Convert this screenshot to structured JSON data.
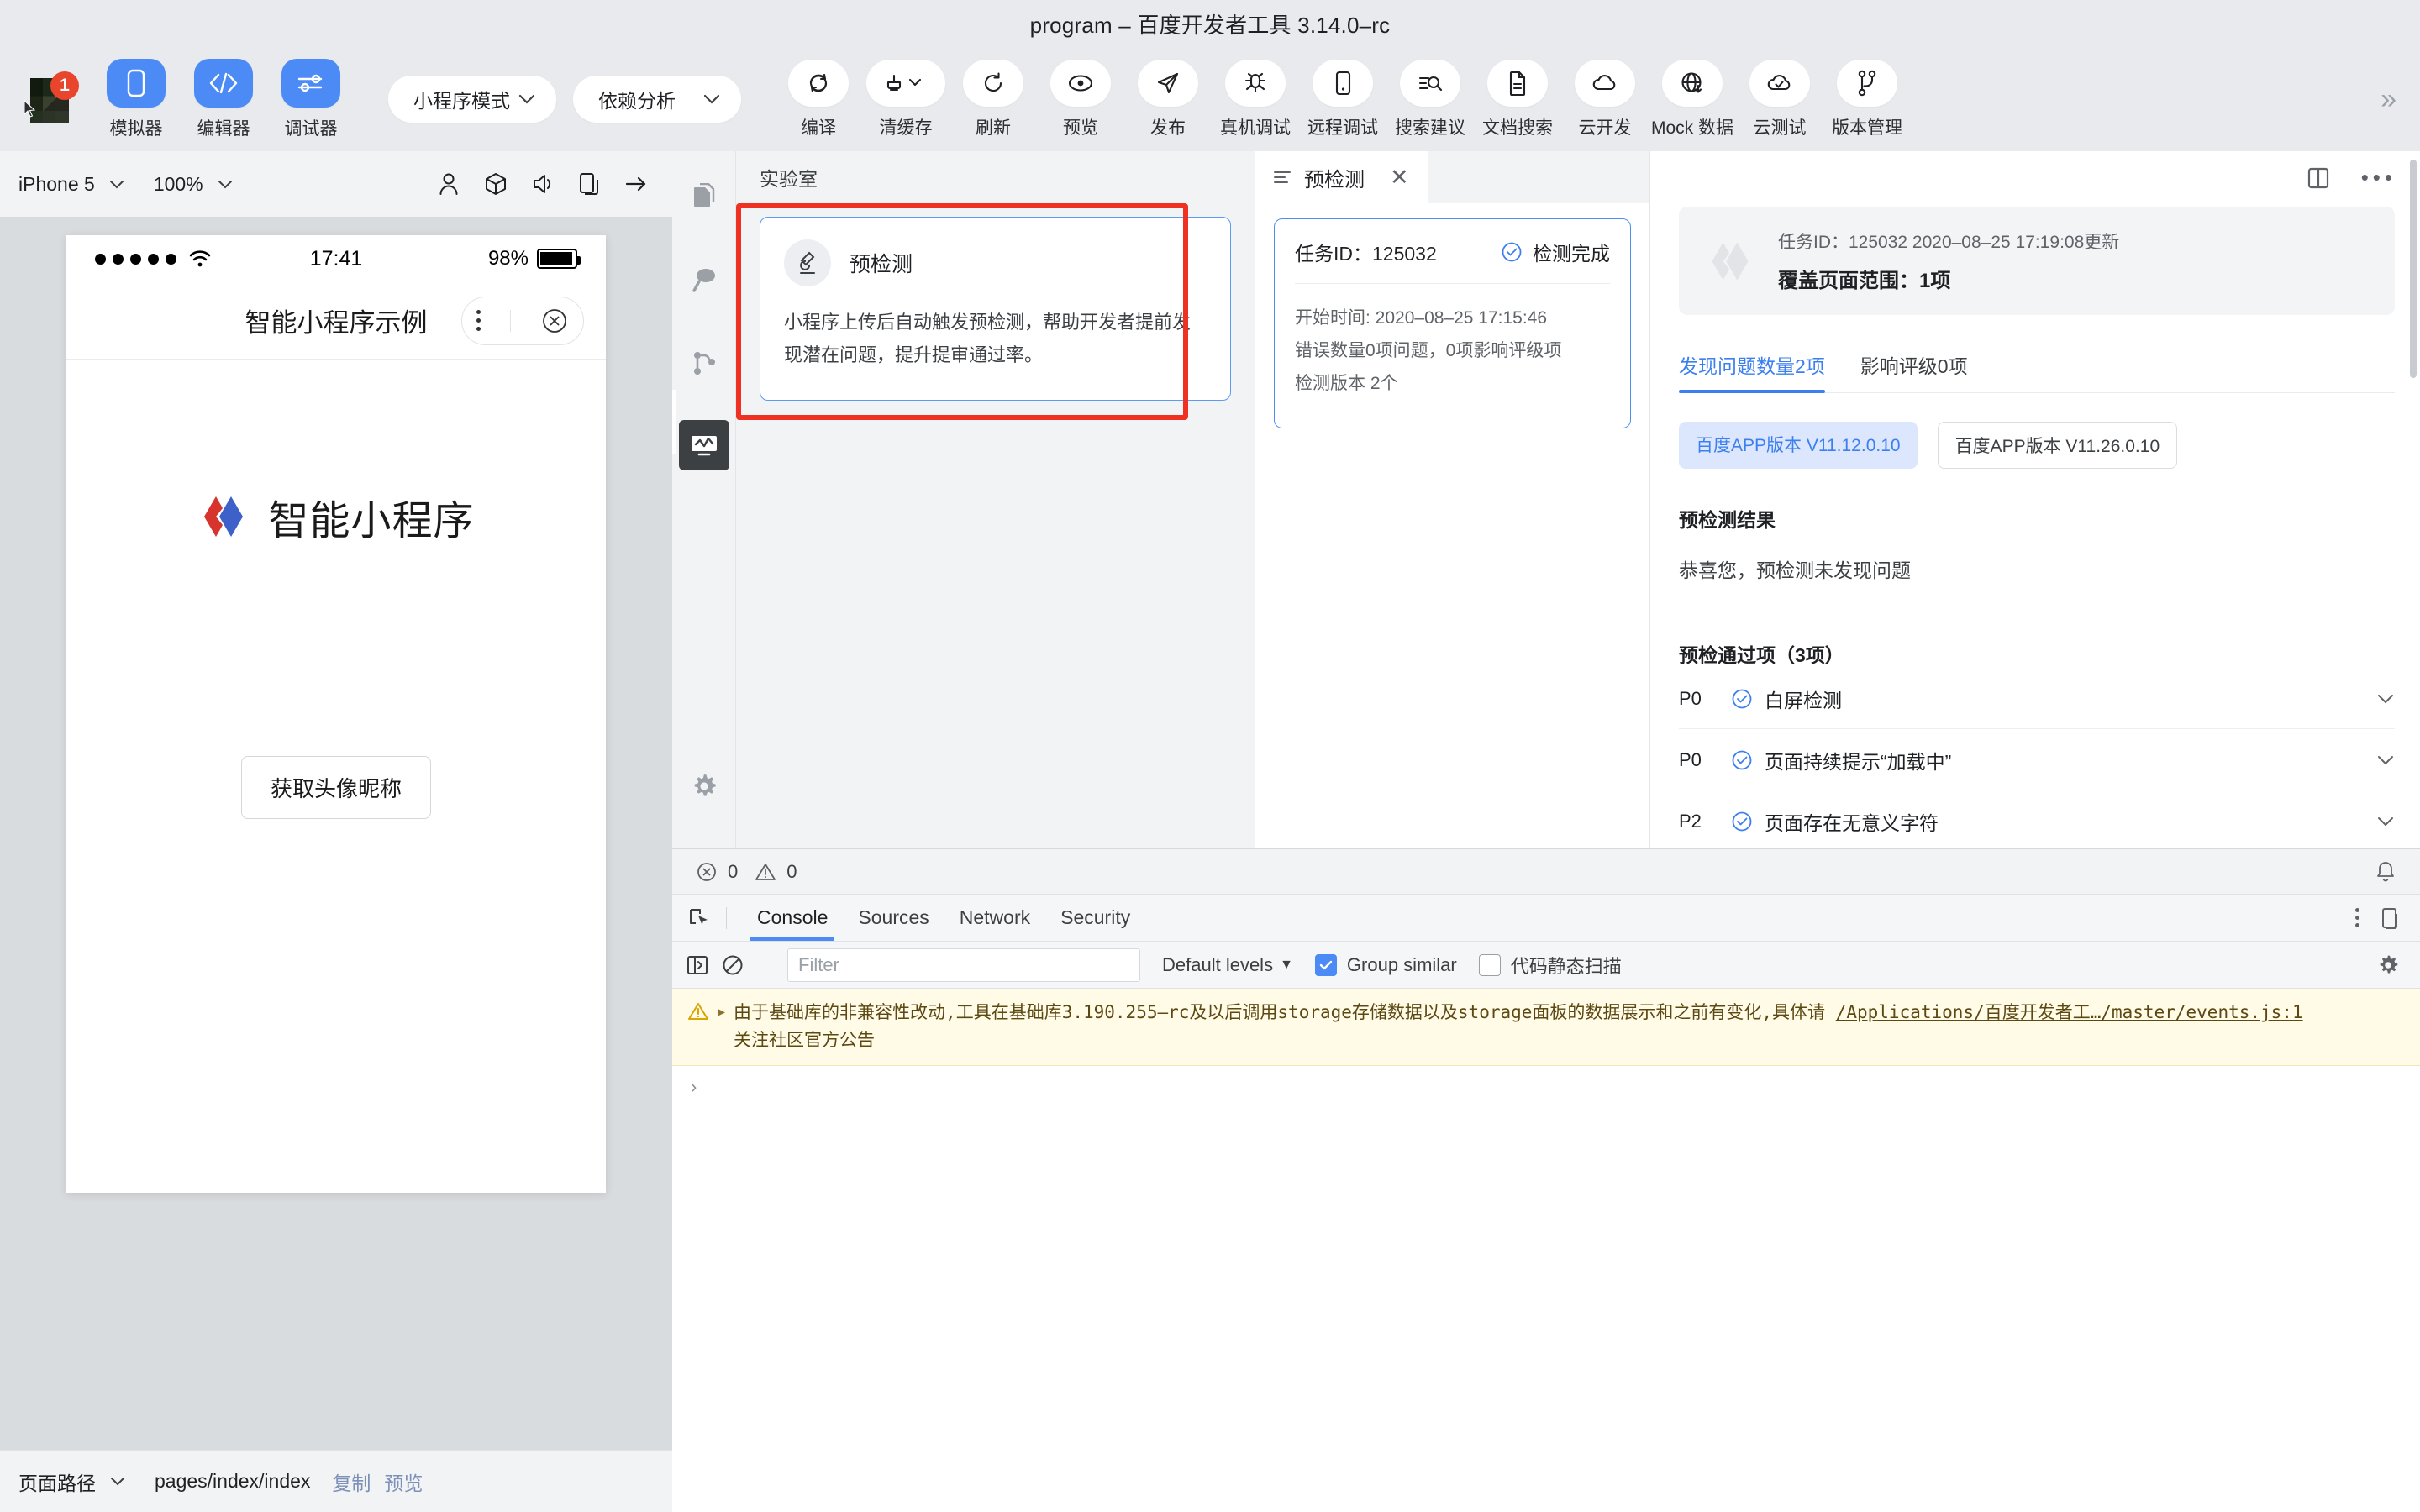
{
  "window": {
    "title": "program – 百度开发者工具 3.14.0–rc"
  },
  "toolbar": {
    "badge_count": "1",
    "main_buttons": [
      {
        "label": "模拟器",
        "icon": "phone-icon"
      },
      {
        "label": "编辑器",
        "icon": "code-icon"
      },
      {
        "label": "调试器",
        "icon": "sliders-icon"
      }
    ],
    "selects": [
      {
        "value": "小程序模式",
        "icon": "chevron-down-icon"
      },
      {
        "value": "依赖分析",
        "icon": "chevron-down-icon"
      }
    ],
    "action_buttons": [
      {
        "label": "编译",
        "icon": "compile-icon"
      },
      {
        "label": "清缓存",
        "icon": "clear-cache-icon"
      },
      {
        "label": "刷新",
        "icon": "refresh-icon"
      },
      {
        "label": "预览",
        "icon": "eye-icon"
      },
      {
        "label": "发布",
        "icon": "send-icon"
      },
      {
        "label": "真机调试",
        "icon": "bug-icon"
      },
      {
        "label": "远程调试",
        "icon": "mobile-icon"
      },
      {
        "label": "搜索建议",
        "icon": "search-list-icon"
      },
      {
        "label": "文档搜索",
        "icon": "document-icon"
      },
      {
        "label": "云开发",
        "icon": "cloud-icon"
      },
      {
        "label": "Mock 数据",
        "icon": "globe-download-icon"
      },
      {
        "label": "云测试",
        "icon": "cloud-check-icon"
      },
      {
        "label": "版本管理",
        "icon": "branch-icon"
      }
    ],
    "overflow": "»"
  },
  "simulator": {
    "device": "iPhone 5",
    "zoom": "100%",
    "icons": [
      "user-icon",
      "cube-icon",
      "volume-icon",
      "rotate-device-icon",
      "arrow-right-icon"
    ],
    "phone": {
      "status_time": "17:41",
      "battery_percent": "98%",
      "nav_title": "智能小程序示例",
      "brand_text": "智能小程序",
      "button_label": "获取头像昵称"
    },
    "bottom": {
      "path_label": "页面路径",
      "path_value": "pages/index/index",
      "copy_label": "复制",
      "preview_label": "预览"
    }
  },
  "rail": {
    "items": [
      {
        "name": "files-icon",
        "active": false
      },
      {
        "name": "search-icon",
        "active": false
      },
      {
        "name": "source-control-icon",
        "active": false
      },
      {
        "name": "analytics-icon",
        "active": true
      }
    ],
    "bottom_item": {
      "name": "gear-icon"
    }
  },
  "lab_pane": {
    "header": "实验室",
    "card": {
      "icon": "microscope-icon",
      "title": "预检测",
      "desc": "小程序上传后自动触发预检测，帮助开发者提前发现潜在问题，提升提审通过率。"
    }
  },
  "task_pane": {
    "tab_label": "预检测",
    "tab_icon": "list-icon",
    "close_icon": "close-icon",
    "card": {
      "task_id_label": "任务ID：",
      "task_id_value": "125032",
      "status": "检测完成",
      "status_icon": "check-circle-icon",
      "start_time": "开始时间: 2020–08–25 17:15:46",
      "errors": "错误数量0项问题，0项影响评级项",
      "versions": "检测版本 2个"
    }
  },
  "detail_pane": {
    "top_icons": [
      "split-pane-icon",
      "more-horizontal-icon"
    ],
    "summary": {
      "logo_icon": "baidu-smartprogram-logo",
      "sub": "任务ID：125032 2020–08–25 17:19:08更新",
      "main": "覆盖页面范围：1项"
    },
    "tabs": [
      {
        "label": "发现问题数量2项",
        "active": true
      },
      {
        "label": "影响评级0项",
        "active": false
      }
    ],
    "chips": [
      {
        "label": "百度APP版本 V11.12.0.10",
        "selected": true
      },
      {
        "label": "百度APP版本 V11.26.0.10",
        "selected": false
      }
    ],
    "result_title": "预检测结果",
    "result_text": "恭喜您，预检测未发现问题",
    "passed_title": "预检通过项（3项）",
    "passed_items": [
      {
        "priority": "P0",
        "label": "白屏检测",
        "icon": "check-circle-icon",
        "chevron": "chevron-down-icon"
      },
      {
        "priority": "P0",
        "label": "页面持续提示“加载中”",
        "icon": "check-circle-icon",
        "chevron": "chevron-down-icon"
      },
      {
        "priority": "P2",
        "label": "页面存在无意义字符",
        "icon": "check-circle-icon",
        "chevron": "chevron-down-icon"
      }
    ]
  },
  "devtools": {
    "counters": {
      "error_count": "0",
      "warn_count": "0",
      "error_icon": "error-circle-icon",
      "warn_icon": "warning-triangle-icon"
    },
    "bell_icon": "bell-icon",
    "inspect_icon": "inspect-icon",
    "tabs": [
      {
        "label": "Console",
        "active": true
      },
      {
        "label": "Sources",
        "active": false
      },
      {
        "label": "Network",
        "active": false
      },
      {
        "label": "Security",
        "active": false
      }
    ],
    "tab_right_icons": [
      "more-vertical-icon",
      "device-toolbar-icon"
    ],
    "filter_bar": {
      "sidebar_icon": "show-sidebar-icon",
      "clear_icon": "clear-console-icon",
      "filter_placeholder": "Filter",
      "levels_label": "Default levels",
      "levels_caret": "▼",
      "group_similar_label": "Group similar",
      "group_similar_checked": true,
      "static_scan_label": "代码静态扫描",
      "static_scan_checked": false,
      "settings_icon": "gear-icon"
    },
    "console_message": {
      "icon": "warning-triangle-icon",
      "expand_caret": "▸",
      "text": "由于基础库的非兼容性改动,工具在基础库3.190.255–rc及以后调用storage存储数据以及storage面板的数据展示和之前有变化,具体请",
      "link": "/Applications/百度开发者工…/master/events.js:1",
      "text2": "关注社区官方公告"
    },
    "prompt_caret": "›"
  },
  "colors": {
    "accent_blue": "#4c8bf5",
    "link_blue": "#3b7ff0",
    "highlight_red": "#ef3124",
    "warn_bg": "#fffbe6",
    "badge_red": "#e8452c"
  }
}
